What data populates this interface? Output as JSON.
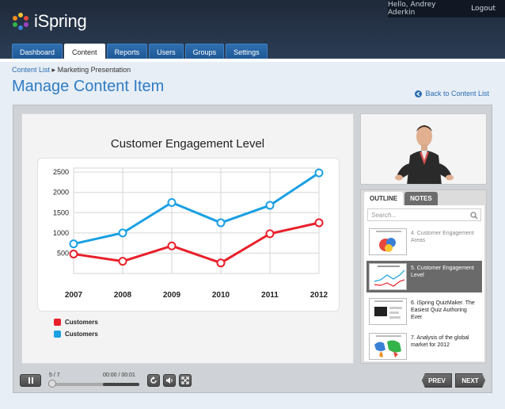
{
  "app": {
    "name": "iSpring"
  },
  "user": {
    "greeting": "Hello, Andrey Aderkin",
    "logout": "Logout"
  },
  "nav": {
    "tabs": [
      {
        "label": "Dashboard",
        "active": false
      },
      {
        "label": "Content",
        "active": true
      },
      {
        "label": "Reports",
        "active": false
      },
      {
        "label": "Users",
        "active": false
      },
      {
        "label": "Groups",
        "active": false
      },
      {
        "label": "Settings",
        "active": false
      }
    ]
  },
  "breadcrumb": {
    "link": "Content List",
    "separator": "▸",
    "current": "Marketing Presentation"
  },
  "page": {
    "title": "Manage Content Item",
    "back_link": "Back to Content List"
  },
  "slide": {
    "title": "Customer Engagement Level"
  },
  "chart_data": {
    "type": "line",
    "title": "Customer Engagement Level",
    "x": [
      "2007",
      "2008",
      "2009",
      "2010",
      "2011",
      "2012"
    ],
    "yticks": [
      500,
      1000,
      1500,
      2000,
      2500
    ],
    "ylim": [
      0,
      2600
    ],
    "grid": true,
    "series": [
      {
        "name": "Customers",
        "color": "#e8202a",
        "values": [
          480,
          300,
          680,
          260,
          980,
          1250
        ]
      },
      {
        "name": "Customers",
        "color": "#1aa0e3",
        "values": [
          730,
          1000,
          1750,
          1250,
          1680,
          2480
        ]
      }
    ],
    "legend_position": "bottom-left"
  },
  "outline": {
    "tabs": [
      {
        "label": "OUTLINE",
        "active": true
      },
      {
        "label": "NOTES",
        "active": false
      }
    ],
    "search_placeholder": "Search...",
    "items": [
      {
        "text": "4. Customer Engagement Areas",
        "selected": false
      },
      {
        "text": "5. Customer Engagement Level",
        "selected": true
      },
      {
        "text": "6. iSpring QuizMaker. The Easiest Quiz Authoring Ever",
        "selected": false
      },
      {
        "text": "7. Analysis of the global market for 2012",
        "selected": false
      }
    ]
  },
  "player": {
    "slide_counter": "5 / 7",
    "time": "00:00 / 00:01",
    "progress": 0.6,
    "prev_label": "PREV",
    "next_label": "NEXT"
  }
}
